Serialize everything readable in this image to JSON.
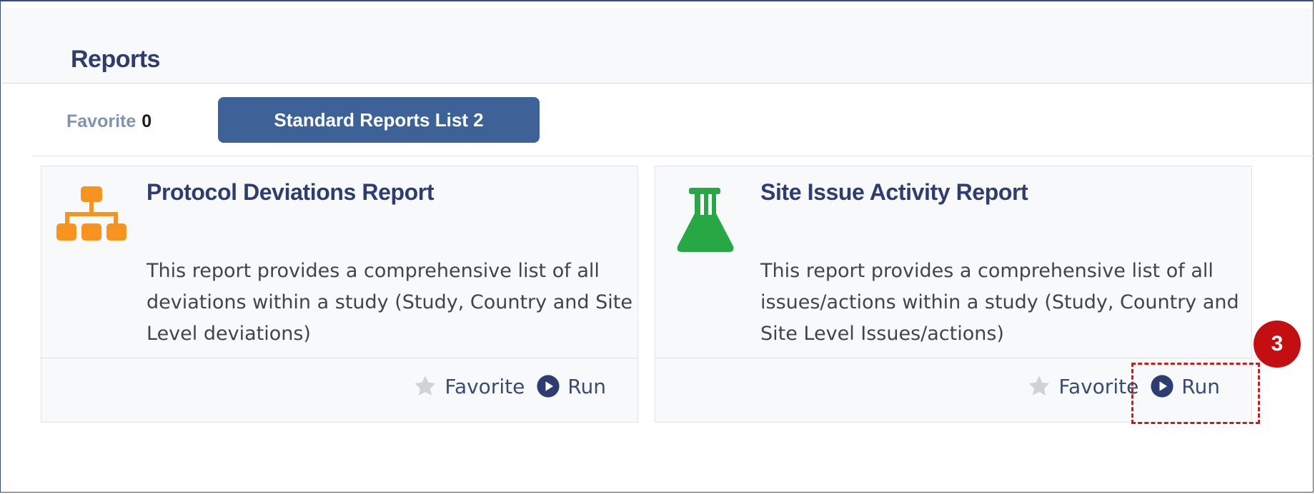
{
  "header": {
    "title": "Reports"
  },
  "tabs": {
    "favorite": {
      "label": "Favorite",
      "count": "0"
    },
    "standard": {
      "label": "Standard Reports List 2"
    }
  },
  "cards": [
    {
      "title": "Protocol Deviations Report",
      "description": "This report provides a comprehensive list of all deviations within a study (Study, Country and Site Level deviations)",
      "icon": "org-chart-icon",
      "icon_color": "#f7931e",
      "favorite_label": "Favorite",
      "run_label": "Run"
    },
    {
      "title": "Site Issue Activity Report",
      "description": "This report provides a comprehensive list of all issues/actions within a study (Study, Country and Site Level Issues/actions)",
      "icon": "flask-icon",
      "icon_color": "#28a745",
      "favorite_label": "Favorite",
      "run_label": "Run"
    }
  ],
  "annotation": {
    "step_number": "3",
    "color": "#c40f12"
  },
  "colors": {
    "accent": "#3c6297",
    "title": "#2d3d70"
  }
}
